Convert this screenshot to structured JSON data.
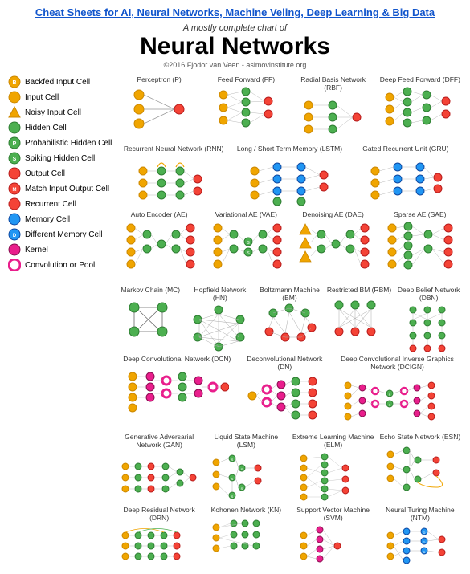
{
  "header": {
    "title": "Cheat Sheets for AI, Neural Networks, Machine Veling, Deep Learning & Big Data",
    "subtitle": "A mostly complete chart of",
    "main_title": "Neural Networks",
    "credit": "©2016 Fjodor van Veen - asimovinstitute.org"
  },
  "legend": {
    "items": [
      {
        "label": "Backfed Input Cell",
        "color": "#f0a500",
        "type": "circle",
        "letter": ""
      },
      {
        "label": "Input Cell",
        "color": "#f0a500",
        "type": "circle",
        "letter": ""
      },
      {
        "label": "Noisy Input Cell",
        "color": "#f0a500",
        "type": "triangle",
        "letter": ""
      },
      {
        "label": "Hidden Cell",
        "color": "#4caf50",
        "type": "circle",
        "letter": ""
      },
      {
        "label": "Probabilistic Hidden Cell",
        "color": "#4caf50",
        "type": "circle",
        "letter": "P"
      },
      {
        "label": "Spiking Hidden Cell",
        "color": "#4caf50",
        "type": "circle",
        "letter": "S"
      },
      {
        "label": "Output Cell",
        "color": "#f44336",
        "type": "circle",
        "letter": ""
      },
      {
        "label": "Match Input Output Cell",
        "color": "#f44336",
        "type": "circle",
        "letter": ""
      },
      {
        "label": "Recurrent Cell",
        "color": "#f44336",
        "type": "circle",
        "letter": ""
      },
      {
        "label": "Memory Cell",
        "color": "#2196f3",
        "type": "circle",
        "letter": ""
      },
      {
        "label": "Different Memory Cell",
        "color": "#2196f3",
        "type": "circle",
        "letter": ""
      },
      {
        "label": "Kernel",
        "color": "#e91e8c",
        "type": "circle",
        "letter": ""
      },
      {
        "label": "Convolution or Pool",
        "color": "#e91e8c",
        "type": "ring",
        "letter": ""
      }
    ]
  },
  "networks": {
    "row1": [
      {
        "label": "Perceptron (P)",
        "id": "perceptron"
      },
      {
        "label": "Feed Forward (FF)",
        "id": "ff"
      },
      {
        "label": "Radial Basis Network (RBF)",
        "id": "rbf"
      },
      {
        "label": "Deep Feed Forward (DFF)",
        "id": "dff"
      }
    ],
    "row2": [
      {
        "label": "Recurrent Neural Network (RNN)",
        "id": "rnn"
      },
      {
        "label": "Long / Short Term Memory (LSTM)",
        "id": "lstm"
      },
      {
        "label": "Gated Recurrent Unit (GRU)",
        "id": "gru"
      }
    ],
    "row3": [
      {
        "label": "Auto Encoder (AE)",
        "id": "ae"
      },
      {
        "label": "Variational AE (VAE)",
        "id": "vae"
      },
      {
        "label": "Denoising AE (DAE)",
        "id": "dae"
      },
      {
        "label": "Sparse AE (SAE)",
        "id": "sae"
      }
    ],
    "row4": [
      {
        "label": "Markov Chain (MC)",
        "id": "mc"
      },
      {
        "label": "Hopfield Network (HN)",
        "id": "hn"
      },
      {
        "label": "Boltzmann Machine (BM)",
        "id": "bm"
      },
      {
        "label": "Restricted BM (RBM)",
        "id": "rbm"
      },
      {
        "label": "Deep Belief Network (DBN)",
        "id": "dbn"
      }
    ],
    "row5": [
      {
        "label": "Deep Convolutional Network (DCN)",
        "id": "dcn"
      },
      {
        "label": "Deconvolutional Network (DN)",
        "id": "dn"
      },
      {
        "label": "Deep Convolutional Inverse Graphics Network (DCIGN)",
        "id": "dcign"
      }
    ],
    "row6": [
      {
        "label": "Generative Adversarial Network (GAN)",
        "id": "gan"
      },
      {
        "label": "Liquid State Machine (LSM)",
        "id": "lsm"
      },
      {
        "label": "Extreme Learning Machine (ELM)",
        "id": "elm"
      },
      {
        "label": "Echo State Network (ESN)",
        "id": "esn"
      }
    ],
    "row7": [
      {
        "label": "Deep Residual Network (DRN)",
        "id": "drn"
      },
      {
        "label": "Kohonen Network (KN)",
        "id": "kn"
      },
      {
        "label": "Support Vector Machine (SVM)",
        "id": "svm"
      },
      {
        "label": "Neural Turing Machine (NTM)",
        "id": "ntm"
      }
    ]
  },
  "colors": {
    "orange": "#f0a500",
    "green": "#4caf50",
    "red": "#f44336",
    "blue": "#2196f3",
    "pink": "#e91e8c",
    "yellow": "#ffeb3b",
    "light_green": "#8bc34a",
    "purple": "#9c27b0",
    "light_blue": "#03a9f4"
  }
}
